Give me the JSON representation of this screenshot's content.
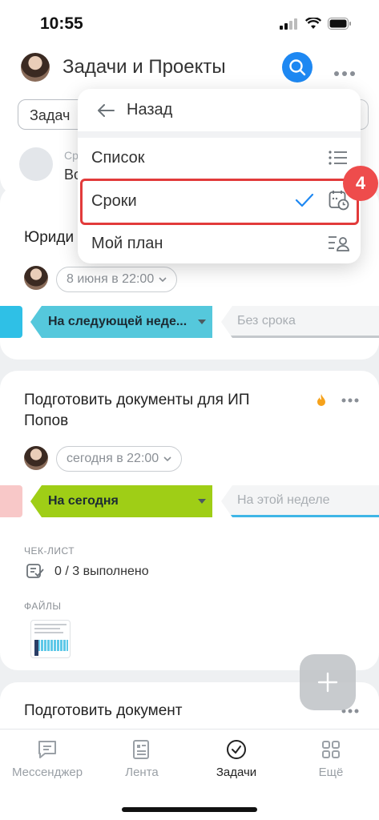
{
  "status_bar": {
    "time": "10:55"
  },
  "header": {
    "title": "Задачи и Проекты",
    "filter_label": "Задач",
    "group_small": "Ср",
    "group_main": "Во"
  },
  "menu": {
    "back_label": "Назад",
    "items": [
      {
        "label": "Список",
        "icon": "list-icon"
      },
      {
        "label": "Сроки",
        "icon": "calendar-clock-icon",
        "selected": true
      },
      {
        "label": "Мой план",
        "icon": "user-list-icon"
      }
    ],
    "step_badge": "4"
  },
  "tasks": [
    {
      "title": "Юриди",
      "date": "8 июня в 22:00",
      "stage": "На следующей неде...",
      "next_stage": "Без срока",
      "stage_color": "#55c8dc"
    },
    {
      "title": "Подготовить документы для ИП Попов",
      "date": "сегодня в 22:00",
      "stage": "На сегодня",
      "next_stage": "На этой неделе",
      "stage_color": "#9fce16",
      "checklist_label": "ЧЕК-ЛИСТ",
      "checklist_value": "0 / 3 выполнено",
      "files_label": "ФАЙЛЫ"
    },
    {
      "title": "Подготовить документ"
    }
  ],
  "bottom_nav": [
    {
      "label": "Мессенджер",
      "icon": "chat-icon"
    },
    {
      "label": "Лента",
      "icon": "feed-icon"
    },
    {
      "label": "Задачи",
      "icon": "check-circle-icon",
      "active": true
    },
    {
      "label": "Ещё",
      "icon": "grid-icon"
    }
  ],
  "colors": {
    "accent": "#1e88f2",
    "highlight": "#e23b3b",
    "badge": "#ee4c4c"
  }
}
